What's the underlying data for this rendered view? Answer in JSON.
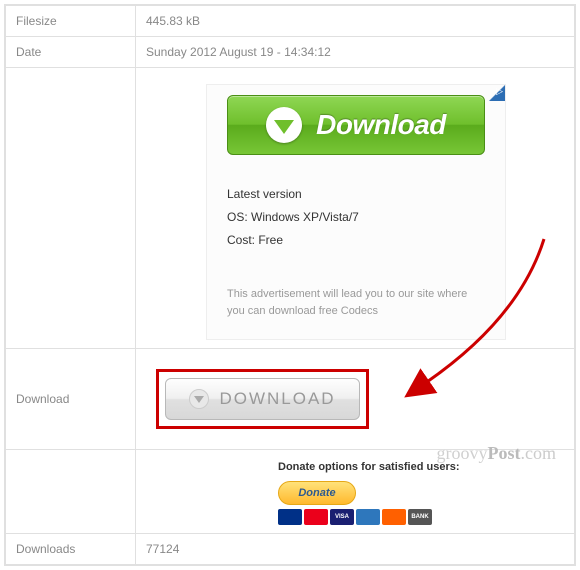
{
  "rows": {
    "filesize": {
      "label": "Filesize",
      "value": "445.83 kB"
    },
    "date": {
      "label": "Date",
      "value": "Sunday 2012 August 19 - 14:34:12"
    },
    "download": {
      "label": "Download"
    },
    "downloads": {
      "label": "Downloads",
      "value": "77124"
    }
  },
  "ad": {
    "button_text": "Download",
    "info_version": "Latest version",
    "info_os": "OS: Windows XP/Vista/7",
    "info_cost": "Cost: Free",
    "disclaimer": "This advertisement will lead you to our site where you can download free Codecs"
  },
  "gray_button": "DOWNLOAD",
  "donate": {
    "text": "Donate options for satisfied users:",
    "button": "Donate"
  },
  "watermark": {
    "brand1": "groovy",
    "brand2": "Post",
    "suffix": ".com"
  }
}
